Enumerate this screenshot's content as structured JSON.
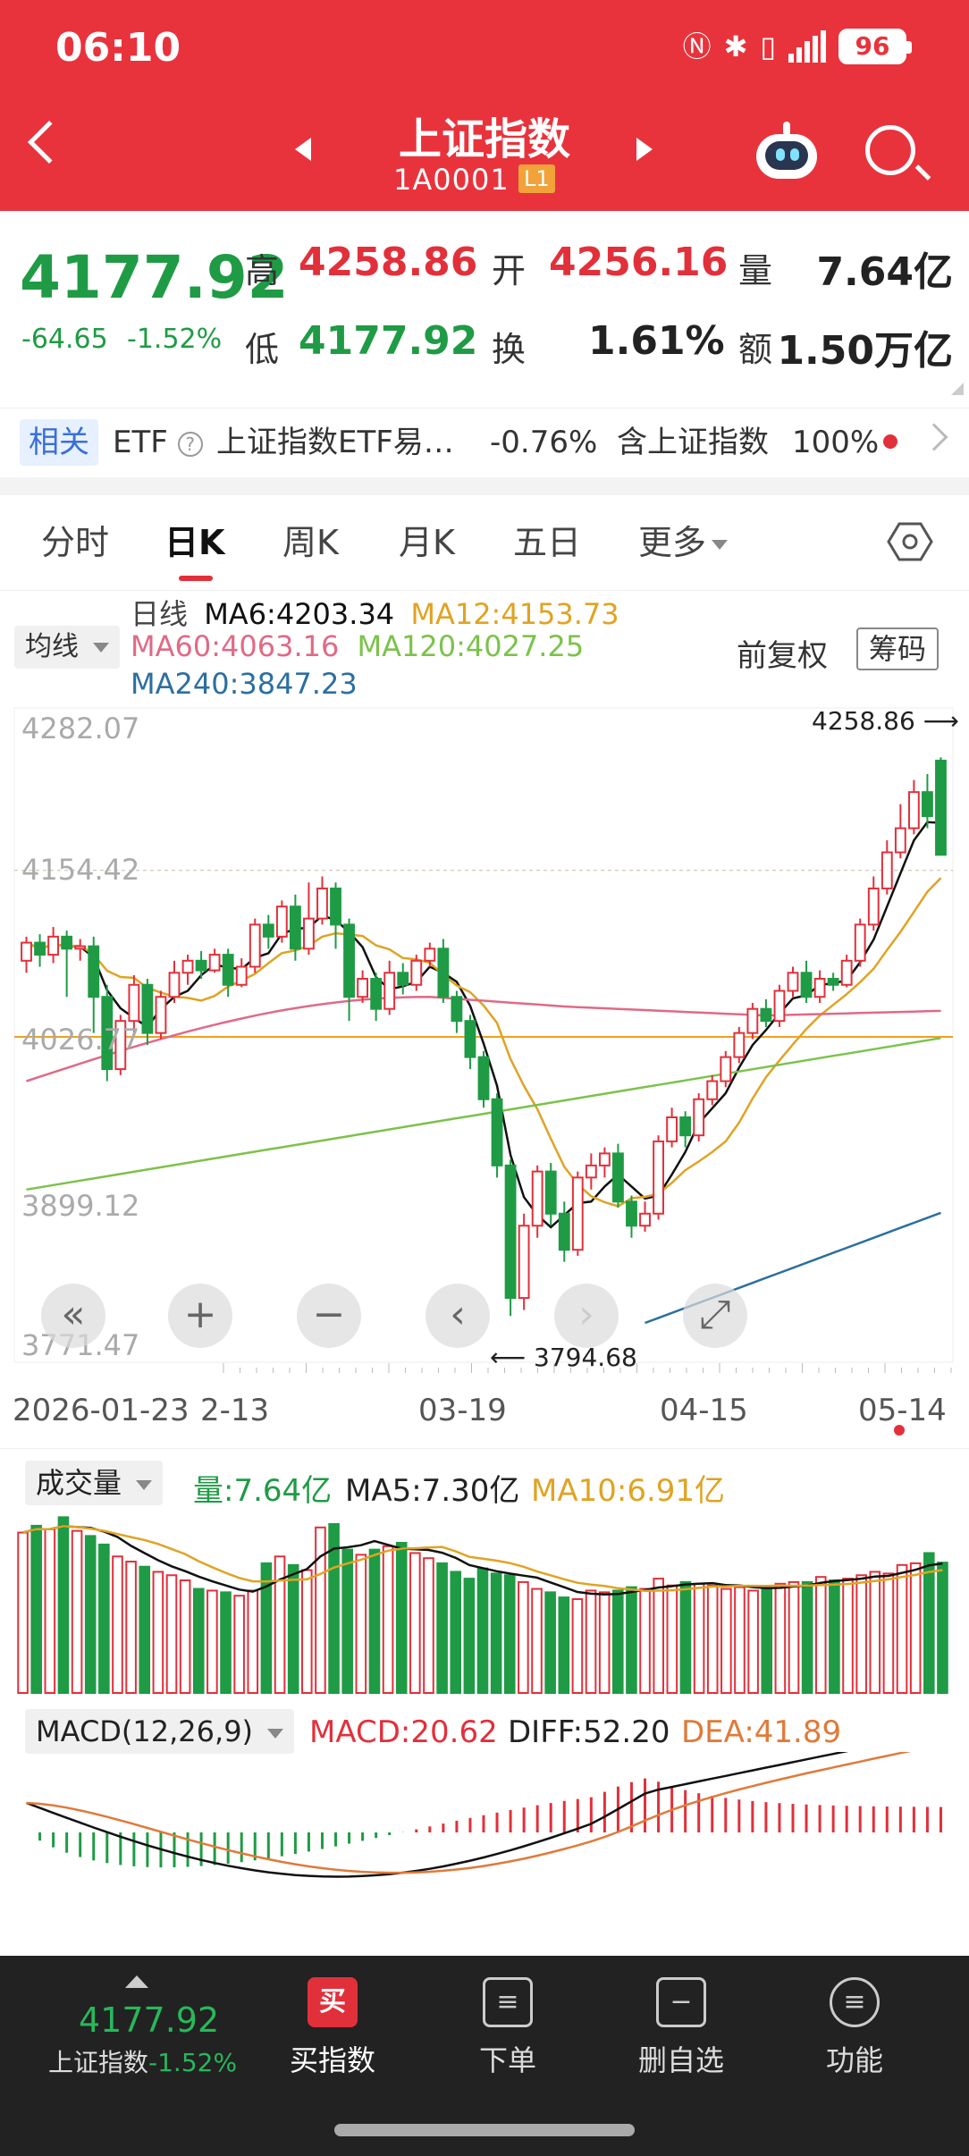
{
  "status_bar": {
    "time": "06:10",
    "battery": "96"
  },
  "header": {
    "title": "上证指数",
    "code": "1A0001",
    "level": "L1"
  },
  "quote": {
    "price": "4177.92",
    "change": "-64.65",
    "change_pct": "-1.52%",
    "high_label": "高",
    "high": "4258.86",
    "open_label": "开",
    "open": "4256.16",
    "volume_label": "量",
    "volume": "7.64亿",
    "low_label": "低",
    "low": "4177.92",
    "turnover_label": "换",
    "turnover": "1.61%",
    "amount_label": "额",
    "amount": "1.50万亿"
  },
  "related": {
    "tag": "相关",
    "etf_label": "ETF",
    "etf_name": "上证指数ETF易…",
    "etf_change": "-0.76%",
    "contain_label": "含上证指数",
    "contain_pct": "100%"
  },
  "tabs": [
    "分时",
    "日K",
    "周K",
    "月K",
    "五日",
    "更多"
  ],
  "ma_legend": {
    "daily": "日线",
    "ma6": "MA6:4203.34",
    "ma12": "MA12:4153.73",
    "ma60": "MA60:4063.16",
    "ma120": "MA120:4027.25",
    "ma240": "MA240:3847.23",
    "mode": "均线",
    "adjust": "前复权",
    "chips": "筹码"
  },
  "colors": {
    "red": "#e2303b",
    "green": "#1f9b45",
    "ma6": "#111111",
    "ma12": "#e0a323",
    "ma60": "#e06a86",
    "ma120": "#7cc24b",
    "ma240": "#2c6fa0"
  },
  "chart_data": {
    "type": "candlestick",
    "y_ticks": [
      "4282.07",
      "4154.42",
      "4026.77",
      "3899.12",
      "3771.47"
    ],
    "ylim": [
      3771.47,
      4282.07
    ],
    "x_labels": [
      "2026-01-23",
      "2-13",
      "03-19",
      "04-15",
      "05-14"
    ],
    "max_label": "4258.86",
    "min_label": "3794.68",
    "candles": [
      [
        4090,
        4105,
        4080,
        4110
      ],
      [
        4105,
        4095,
        4085,
        4112
      ],
      [
        4095,
        4110,
        4088,
        4118
      ],
      [
        4110,
        4100,
        4060,
        4115
      ],
      [
        4100,
        4102,
        4090,
        4108
      ],
      [
        4102,
        4060,
        4030,
        4110
      ],
      [
        4060,
        4000,
        3990,
        4070
      ],
      [
        4000,
        4040,
        3995,
        4045
      ],
      [
        4040,
        4070,
        4030,
        4078
      ],
      [
        4070,
        4030,
        4020,
        4075
      ],
      [
        4030,
        4060,
        4025,
        4065
      ],
      [
        4060,
        4080,
        4055,
        4090
      ],
      [
        4080,
        4090,
        4070,
        4095
      ],
      [
        4090,
        4082,
        4075,
        4098
      ],
      [
        4082,
        4095,
        4080,
        4100
      ],
      [
        4095,
        4070,
        4060,
        4100
      ],
      [
        4070,
        4085,
        4068,
        4092
      ],
      [
        4085,
        4120,
        4080,
        4125
      ],
      [
        4120,
        4110,
        4100,
        4128
      ],
      [
        4110,
        4135,
        4105,
        4140
      ],
      [
        4135,
        4100,
        4090,
        4145
      ],
      [
        4100,
        4125,
        4095,
        4155
      ],
      [
        4125,
        4150,
        4120,
        4160
      ],
      [
        4150,
        4120,
        4100,
        4155
      ],
      [
        4120,
        4060,
        4040,
        4125
      ],
      [
        4060,
        4075,
        4055,
        4082
      ],
      [
        4075,
        4050,
        4040,
        4080
      ],
      [
        4050,
        4080,
        4045,
        4090
      ],
      [
        4080,
        4070,
        4062,
        4088
      ],
      [
        4070,
        4090,
        4065,
        4095
      ],
      [
        4090,
        4100,
        4085,
        4105
      ],
      [
        4100,
        4060,
        4055,
        4108
      ],
      [
        4060,
        4040,
        4030,
        4065
      ],
      [
        4040,
        4010,
        4000,
        4045
      ],
      [
        4010,
        3975,
        3968,
        4015
      ],
      [
        3975,
        3920,
        3910,
        3980
      ],
      [
        3920,
        3810,
        3795,
        3925
      ],
      [
        3810,
        3870,
        3800,
        3880
      ],
      [
        3870,
        3915,
        3860,
        3920
      ],
      [
        3915,
        3880,
        3870,
        3922
      ],
      [
        3880,
        3850,
        3840,
        3890
      ],
      [
        3850,
        3910,
        3845,
        3915
      ],
      [
        3910,
        3920,
        3900,
        3930
      ],
      [
        3920,
        3930,
        3910,
        3935
      ],
      [
        3930,
        3890,
        3885,
        3938
      ],
      [
        3890,
        3870,
        3860,
        3895
      ],
      [
        3870,
        3880,
        3865,
        3890
      ],
      [
        3880,
        3940,
        3875,
        3945
      ],
      [
        3940,
        3960,
        3935,
        3968
      ],
      [
        3960,
        3945,
        3935,
        3965
      ],
      [
        3945,
        3975,
        3940,
        3980
      ],
      [
        3975,
        3990,
        3970,
        3995
      ],
      [
        3990,
        4010,
        3985,
        4015
      ],
      [
        4010,
        4030,
        4005,
        4035
      ],
      [
        4030,
        4050,
        4025,
        4055
      ],
      [
        4050,
        4040,
        4035,
        4058
      ],
      [
        4040,
        4065,
        4035,
        4070
      ],
      [
        4065,
        4080,
        4060,
        4085
      ],
      [
        4080,
        4060,
        4055,
        4090
      ],
      [
        4060,
        4075,
        4055,
        4082
      ],
      [
        4075,
        4070,
        4065,
        4080
      ],
      [
        4070,
        4090,
        4068,
        4095
      ],
      [
        4090,
        4120,
        4085,
        4125
      ],
      [
        4120,
        4150,
        4115,
        4160
      ],
      [
        4150,
        4180,
        4145,
        4190
      ],
      [
        4180,
        4200,
        4175,
        4220
      ],
      [
        4200,
        4230,
        4195,
        4240
      ],
      [
        4230,
        4210,
        4200,
        4245
      ],
      [
        4256.16,
        4177.92,
        4177.92,
        4258.86
      ]
    ]
  },
  "volume": {
    "tag": "成交量",
    "vol": "量:7.64亿",
    "ma5": "MA5:7.30亿",
    "ma10": "MA10:6.91亿",
    "values": [
      9.4,
      9.8,
      9.6,
      10.3,
      9.5,
      9.2,
      8.7,
      8.0,
      7.7,
      7.4,
      7.1,
      6.9,
      6.6,
      6.1,
      6.0,
      5.9,
      5.7,
      6.0,
      7.6,
      8.0,
      7.5,
      7.2,
      9.7,
      9.9,
      8.4,
      8.1,
      8.4,
      8.6,
      8.8,
      8.2,
      7.9,
      7.6,
      7.1,
      6.7,
      7.3,
      7.0,
      6.9,
      6.5,
      6.1,
      5.9,
      5.6,
      5.5,
      6.0,
      5.9,
      6.0,
      6.2,
      6.1,
      6.7,
      6.3,
      6.5,
      6.4,
      6.3,
      6.1,
      6.2,
      6.0,
      6.1,
      6.4,
      6.5,
      6.5,
      6.8,
      6.6,
      6.7,
      6.9,
      7.1,
      7.0,
      7.5,
      7.6,
      8.2,
      7.64
    ]
  },
  "macd": {
    "tag": "MACD(12,26,9)",
    "macd": "MACD:20.62",
    "diff": "DIFF:52.20",
    "dea": "DEA:41.89"
  },
  "bottom_bar": {
    "price": "4177.92",
    "name": "上证指数",
    "pct": "-1.52%",
    "buy": "买指数",
    "buy_icon": "买",
    "order": "下单",
    "remove": "删自选",
    "func": "功能"
  }
}
